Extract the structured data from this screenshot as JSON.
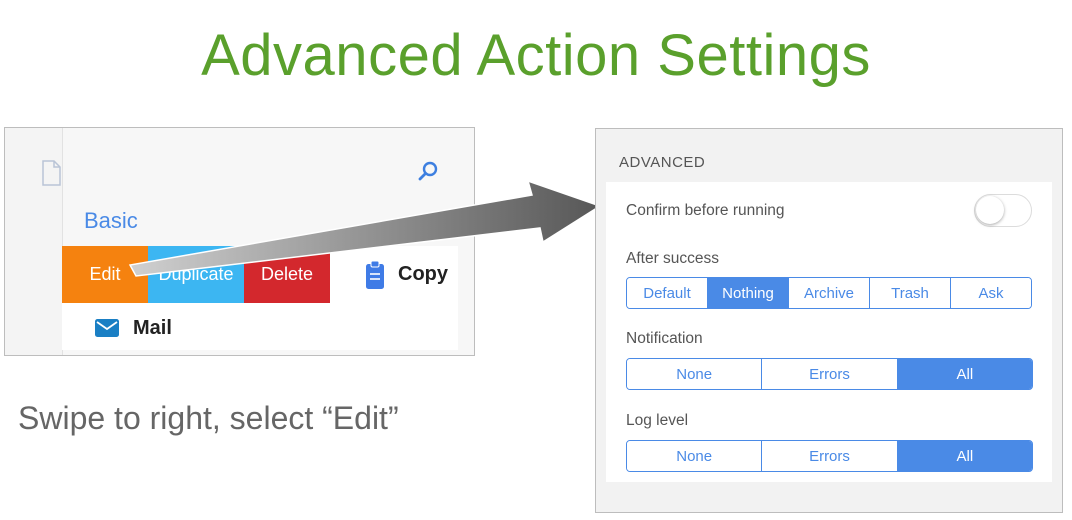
{
  "title": "Advanced Action Settings",
  "caption": "Swipe to right, select “Edit”",
  "left_panel": {
    "section": "Basic",
    "actions": {
      "edit": "Edit",
      "duplicate": "Duplicate",
      "delete": "Delete"
    },
    "rows": [
      {
        "label": "Copy",
        "icon": "clipboard-icon"
      },
      {
        "label": "Mail",
        "icon": "mail-icon"
      }
    ],
    "icons": [
      "document-icon",
      "search-icon"
    ]
  },
  "right_panel": {
    "section_header": "ADVANCED",
    "confirm_label": "Confirm before running",
    "confirm_on": false,
    "after_success": {
      "label": "After success",
      "options": [
        "Default",
        "Nothing",
        "Archive",
        "Trash",
        "Ask"
      ],
      "selected": "Nothing"
    },
    "notification": {
      "label": "Notification",
      "options": [
        "None",
        "Errors",
        "All"
      ],
      "selected": "All"
    },
    "log_level": {
      "label": "Log level",
      "options": [
        "None",
        "Errors",
        "All"
      ],
      "selected": "All"
    }
  },
  "colors": {
    "title": "#5aa02c",
    "edit": "#f5820f",
    "duplicate": "#3cb6f2",
    "delete": "#d3282d",
    "accent": "#4a8ae6"
  }
}
